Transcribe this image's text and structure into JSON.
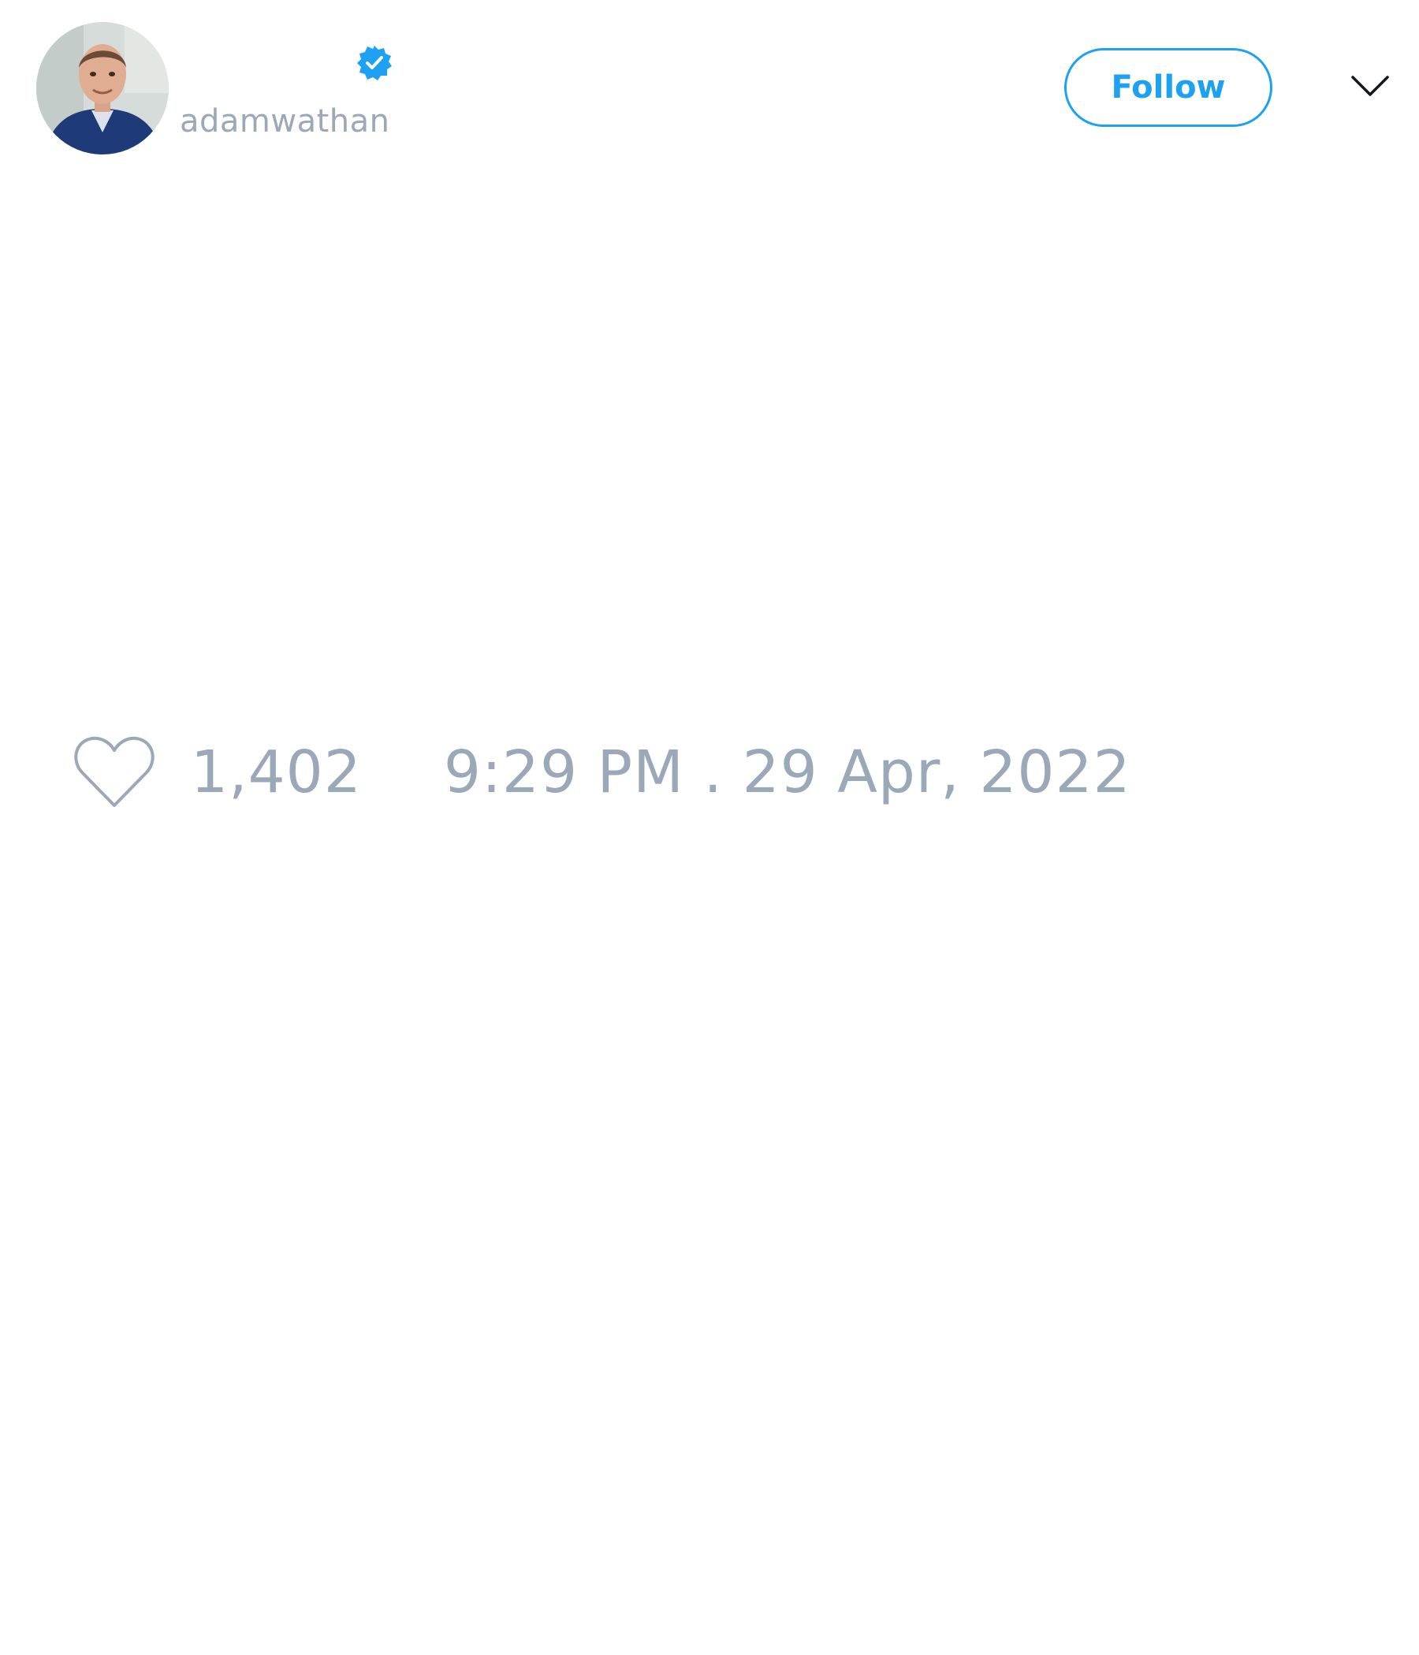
{
  "tweet": {
    "author": {
      "display_name": "",
      "handle": "adamwathan",
      "verified": true,
      "avatar_icon": "profile-photo"
    },
    "follow_label": "Follow",
    "more_icon": "chevron-down-icon",
    "text": "",
    "like_icon": "heart-outline-icon",
    "like_count": "1,402",
    "timestamp": "9:29 PM . 29 Apr, 2022"
  },
  "colors": {
    "accent": "#1da1f2",
    "muted_text": "#9ba8b8",
    "background": "#ffffff"
  }
}
